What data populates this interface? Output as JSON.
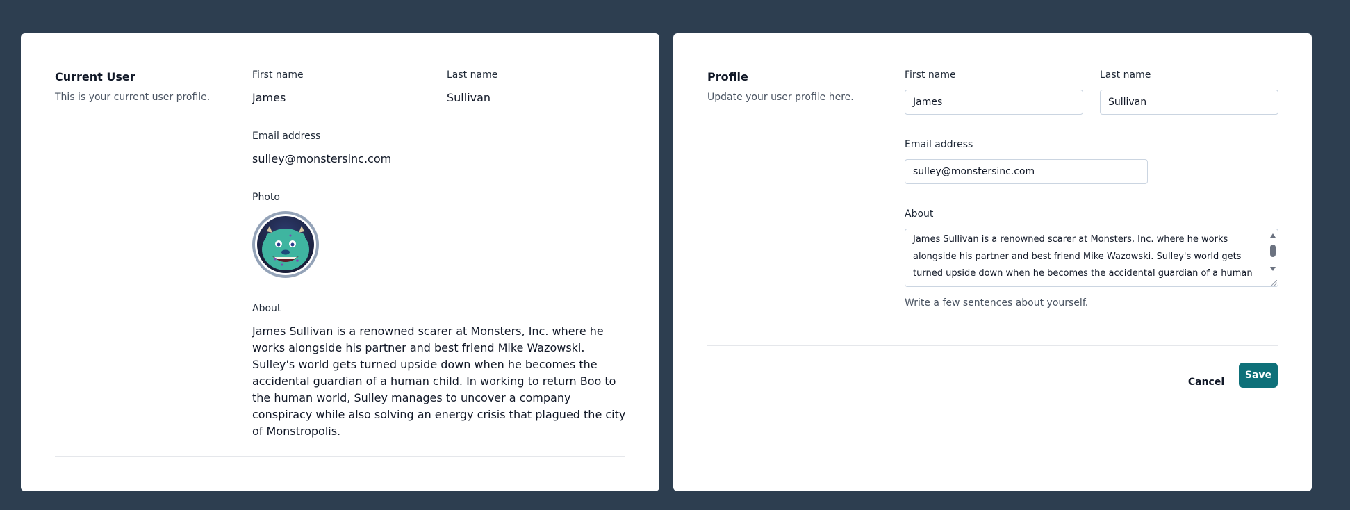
{
  "current_user": {
    "title": "Current User",
    "description": "This is your current user profile.",
    "first_name_label": "First name",
    "first_name": "James",
    "last_name_label": "Last name",
    "last_name": "Sullivan",
    "email_label": "Email address",
    "email": "sulley@monstersinc.com",
    "photo_label": "Photo",
    "about_label": "About",
    "about": "James Sullivan is a renowned scarer at Monsters, Inc. where he works alongside his partner and best friend Mike Wazowski. Sulley's world gets turned upside down when he becomes the accidental guardian of a human child. In working to return Boo to the human world, Sulley manages to uncover a company conspiracy while also solving an energy crisis that plagued the city of Monstropolis."
  },
  "profile_form": {
    "title": "Profile",
    "description": "Update your user profile here.",
    "first_name_label": "First name",
    "first_name_value": "James",
    "last_name_label": "Last name",
    "last_name_value": "Sullivan",
    "email_label": "Email address",
    "email_value": "sulley@monstersinc.com",
    "about_label": "About",
    "about_value": "James Sullivan is a renowned scarer at Monsters, Inc. where he works alongside his partner and best friend Mike Wazowski. Sulley's world gets turned upside down when he becomes the accidental guardian of a human child. In working to return Boo to the human world, Sulley manages to uncover a company conspiracy while also solving an energy crisis that plagued the city of Monstropolis.",
    "about_help": "Write a few sentences about yourself.",
    "cancel_label": "Cancel",
    "save_label": "Save"
  },
  "colors": {
    "background": "#2d3e50",
    "card": "#ffffff",
    "accent": "#0e7079"
  }
}
